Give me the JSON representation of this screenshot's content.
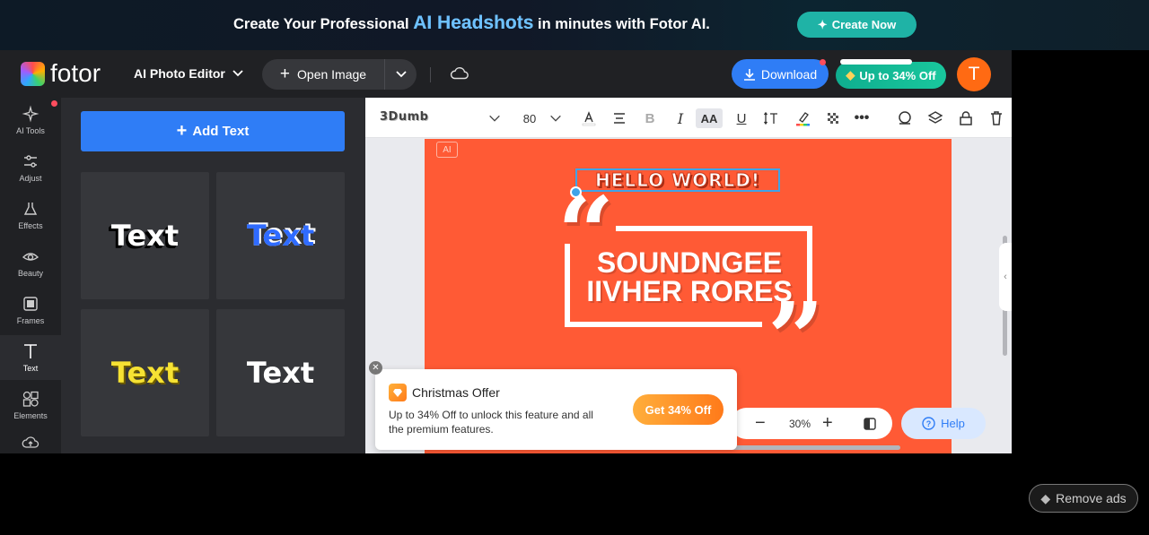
{
  "banner": {
    "prefix": "Create Your Professional",
    "highlight": "AI Headshots",
    "suffix": "in minutes with Fotor AI.",
    "cta": "Create Now"
  },
  "header": {
    "logo_text": "fotor",
    "editor_menu": "AI Photo Editor",
    "open_image": "Open Image",
    "download": "Download",
    "upgrade": "Up to 34% Off",
    "avatar_initial": "T"
  },
  "rail": {
    "items": [
      {
        "label": "AI Tools",
        "icon": "sparkle-icon"
      },
      {
        "label": "Adjust",
        "icon": "sliders-icon"
      },
      {
        "label": "Effects",
        "icon": "flask-icon"
      },
      {
        "label": "Beauty",
        "icon": "eye-icon"
      },
      {
        "label": "Frames",
        "icon": "frame-icon"
      },
      {
        "label": "Text",
        "icon": "text-t-icon"
      },
      {
        "label": "Elements",
        "icon": "shapes-icon"
      }
    ]
  },
  "panel": {
    "add_text": "Add Text",
    "tiles": [
      "Text",
      "Text",
      "Text",
      "Text"
    ]
  },
  "toolbar": {
    "font_name": "3Dumb",
    "font_size": "80"
  },
  "canvas": {
    "ai_badge": "AI",
    "hello": "HELLO WORLD!",
    "line1": "SOUNDNGEE",
    "line2": "IIVHER RORES",
    "background": "#ff5a35"
  },
  "zoom": {
    "value": "30%"
  },
  "help": "Help",
  "offer": {
    "title": "Christmas Offer",
    "description": "Up to 34% Off to unlock this feature and all the premium features.",
    "cta": "Get 34% Off"
  },
  "remove_ads": "Remove ads"
}
